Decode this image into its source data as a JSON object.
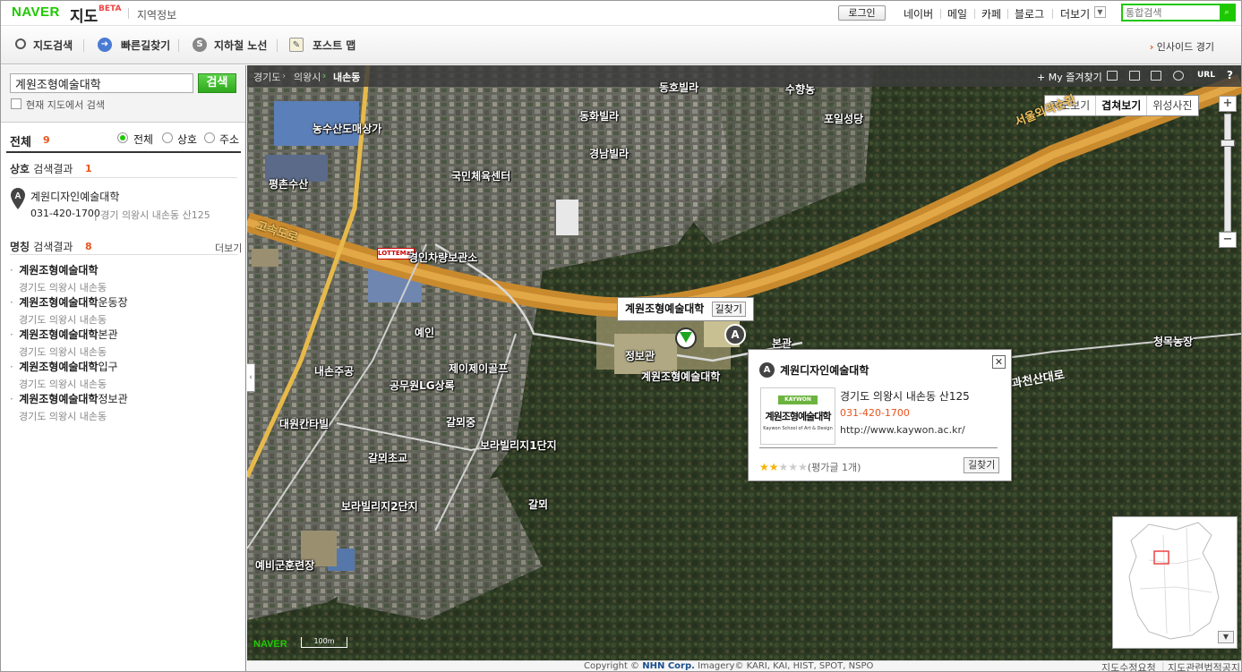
{
  "header": {
    "logo": "NAVER",
    "service": "지도",
    "beta": "BETA",
    "section": "지역정보",
    "login": "로그인",
    "links": [
      "네이버",
      "메일",
      "카페",
      "블로그",
      "더보기"
    ],
    "search_placeholder": "통합검색"
  },
  "toolbar": {
    "items": [
      "지도검색",
      "빠른길찾기",
      "지하철 노선",
      "포스트 맵"
    ],
    "insight": "인사이드 경기"
  },
  "left": {
    "query": "계원조형예술대학",
    "search_button": "검색",
    "current_map_label": "현재 지도에서 검색",
    "tab_all": "전체",
    "tab_all_count": "9",
    "filters": [
      "전체",
      "상호",
      "주소"
    ],
    "business_section_title": "상호",
    "business_section_suffix": "검색결과",
    "business_count": "1",
    "business_result": {
      "marker": "A",
      "name": "계원디자인예술대학",
      "phone": "031-420-1700",
      "address": "경기 의왕시 내손동 산125"
    },
    "landmark_section_title": "명칭",
    "landmark_section_suffix": "검색결과",
    "landmark_count": "8",
    "more": "더보기",
    "landmarks": [
      {
        "name": "계원조형예술대학",
        "suffix": "",
        "address": "경기도 의왕시 내손동"
      },
      {
        "name": "계원조형예술대학",
        "suffix": "운동장",
        "address": "경기도 의왕시 내손동"
      },
      {
        "name": "계원조형예술대학",
        "suffix": "본관",
        "address": "경기도 의왕시 내손동"
      },
      {
        "name": "계원조형예술대학",
        "suffix": "입구",
        "address": "경기도 의왕시 내손동"
      },
      {
        "name": "계원조형예술대학",
        "suffix": "정보관",
        "address": "경기도 의왕시 내손동"
      }
    ]
  },
  "map": {
    "breadcrumb": [
      "경기도",
      "의왕시",
      "내손동"
    ],
    "favorites": "My 즐겨찾기",
    "url_label": "URL",
    "help": "?",
    "view_tabs": [
      "지도보기",
      "겹쳐보기",
      "위성사진"
    ],
    "labels": [
      "동호빌라",
      "동화빌라",
      "경남빌라",
      "국민체육센터",
      "농수산도매상가",
      "평촌수산",
      "포일성당",
      "경인차량보관소",
      "예인",
      "내손주공",
      "공무원LG상록",
      "제이제이골프",
      "갈뫼중",
      "대원칸타빌",
      "갈뫼초교",
      "보라빌리지1단지",
      "보라빌리지2단지",
      "갈뫼",
      "예비군훈련장",
      "정보관",
      "계원조형예술대학",
      "본관",
      "청목농장",
      "수향농"
    ],
    "roads": [
      "서울외곽순환",
      "외곽순환",
      "고속도로",
      "과천산대로"
    ],
    "lotte": "LOTTEMart",
    "callout_name": "계원조형예술대학",
    "callout_route": "길찾기",
    "pin_label": "A",
    "naver_logo": "NAVER",
    "scale": "100m"
  },
  "info_window": {
    "marker": "A",
    "name": "계원디자인예술대학",
    "address": "경기도 의왕시 내손동 산125",
    "phone": "031-420-1700",
    "url": "http://www.kaywon.ac.kr/",
    "logo_top": "KAYWON",
    "logo_main": "계원조형예술대학",
    "logo_sub": "Kaywon School of Art & Design",
    "rating": 2,
    "review_text": "(평가글 1개)",
    "route_button": "길찾기"
  },
  "footer": {
    "copyright_prefix": "Copyright ©",
    "company": "NHN Corp.",
    "imagery": "Imagery© KARI, KAI, HIST, SPOT, NSPO",
    "links": [
      "지도수정요청",
      "지도관련법적공지"
    ]
  }
}
